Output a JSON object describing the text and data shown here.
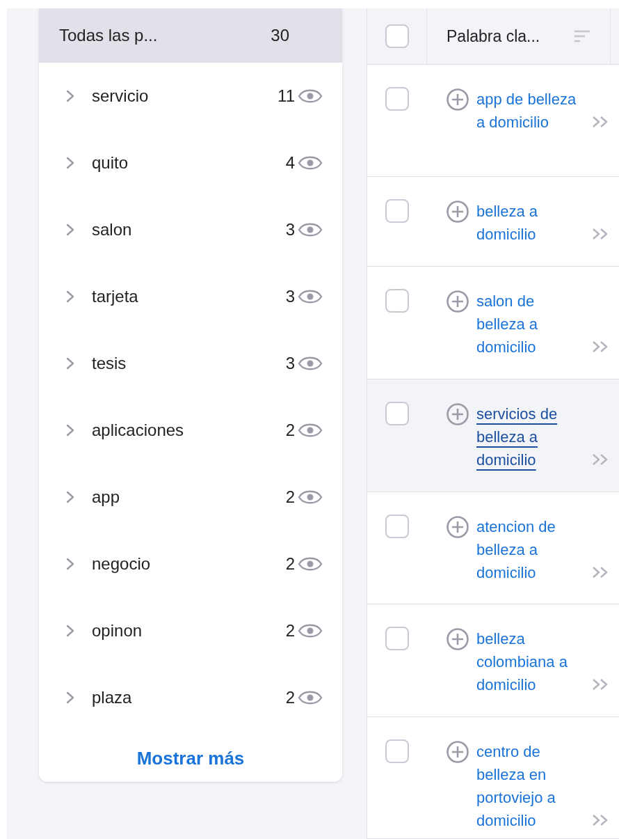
{
  "groups_panel": {
    "header": {
      "label": "Todas las p...",
      "count": "30",
      "selected": true
    },
    "items": [
      {
        "label": "servicio",
        "count": "11",
        "expanded": false
      },
      {
        "label": "quito",
        "count": "4",
        "expanded": false
      },
      {
        "label": "salon",
        "count": "3",
        "expanded": false
      },
      {
        "label": "tarjeta",
        "count": "3",
        "expanded": false
      },
      {
        "label": "tesis",
        "count": "3",
        "expanded": false
      },
      {
        "label": "aplicaciones",
        "count": "2",
        "expanded": false
      },
      {
        "label": "app",
        "count": "2",
        "expanded": false
      },
      {
        "label": "negocio",
        "count": "2",
        "expanded": false
      },
      {
        "label": "opinon",
        "count": "2",
        "expanded": false
      },
      {
        "label": "plaza",
        "count": "2",
        "expanded": false
      }
    ],
    "show_more": "Mostrar más"
  },
  "table": {
    "header": {
      "checked": false,
      "keyword_column": "Palabra cla..."
    },
    "rows": [
      {
        "keyword": "app de belleza a domicilio",
        "checked": false,
        "highlighted": false
      },
      {
        "keyword": "belleza a domicilio",
        "checked": false,
        "highlighted": false
      },
      {
        "keyword": "salon de belleza a domicilio",
        "checked": false,
        "highlighted": false
      },
      {
        "keyword": "servicios de belleza a domicilio",
        "checked": false,
        "highlighted": true
      },
      {
        "keyword": "atencion de belleza a domicilio",
        "checked": false,
        "highlighted": false
      },
      {
        "keyword": "belleza colombiana a domicilio",
        "checked": false,
        "highlighted": false
      },
      {
        "keyword": "centro de belleza en portoviejo a domicilio",
        "checked": false,
        "highlighted": false
      }
    ]
  }
}
